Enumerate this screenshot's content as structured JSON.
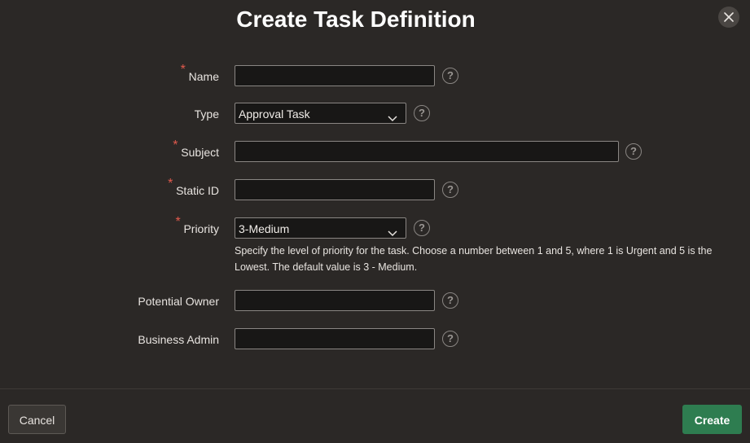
{
  "dialog": {
    "title": "Create Task Definition",
    "close_icon": "close-icon"
  },
  "form": {
    "name": {
      "label": "Name",
      "required": true,
      "value": ""
    },
    "type": {
      "label": "Type",
      "required": false,
      "value": "Approval Task"
    },
    "subject": {
      "label": "Subject",
      "required": true,
      "value": ""
    },
    "static_id": {
      "label": "Static ID",
      "required": true,
      "value": ""
    },
    "priority": {
      "label": "Priority",
      "required": true,
      "value": "3-Medium",
      "help_text": "Specify the level of priority for the task. Choose a number between 1 and 5, where 1 is Urgent and 5 is the Lowest. The default value is 3 - Medium."
    },
    "potential_owner": {
      "label": "Potential Owner",
      "required": false,
      "value": ""
    },
    "business_admin": {
      "label": "Business Admin",
      "required": false,
      "value": ""
    },
    "required_marker": "*",
    "help_glyph": "?"
  },
  "footer": {
    "cancel_label": "Cancel",
    "create_label": "Create"
  },
  "colors": {
    "background": "#2b2826",
    "field_bg": "#181716",
    "required": "#e25a4d",
    "primary_button": "#2e7d50"
  }
}
